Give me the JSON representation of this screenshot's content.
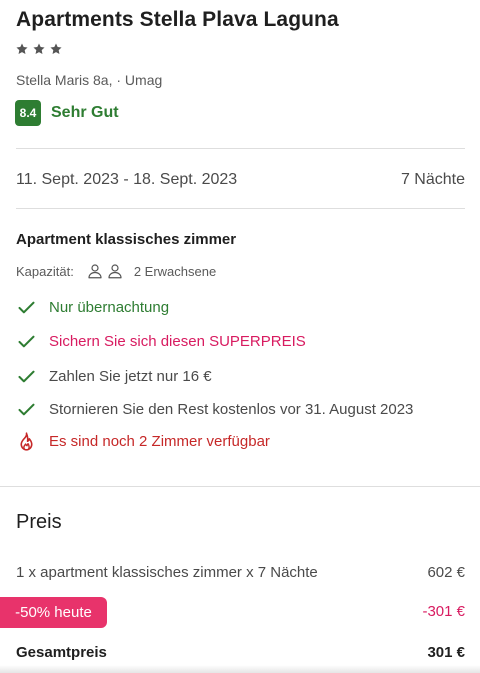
{
  "hotel": {
    "name": "Apartments Stella Plava Laguna",
    "star_count": 3,
    "address": "Stella Maris 8a, · Umag",
    "rating_score": "8.4",
    "rating_label": "Sehr Gut"
  },
  "stay": {
    "dates": "11. Sept. 2023 - 18. Sept. 2023",
    "nights": "7 Nächte"
  },
  "room": {
    "name": "Apartment klassisches zimmer",
    "capacity_label": "Kapazität:",
    "capacity_value": "2 Erwachsene",
    "features": [
      {
        "icon": "check-icon",
        "text": "Nur übernachtung"
      },
      {
        "icon": "check-icon",
        "text": "Sichern Sie sich diesen SUPERPREIS"
      },
      {
        "icon": "check-icon",
        "text": "Zahlen Sie jetzt nur 16 €"
      },
      {
        "icon": "check-icon",
        "text": "Stornieren Sie den Rest kostenlos vor 31. August 2023"
      },
      {
        "icon": "flame-icon",
        "text": "Es sind noch 2 Zimmer verfügbar"
      }
    ]
  },
  "price": {
    "heading": "Preis",
    "line_description": "1 x apartment klassisches zimmer x 7 Nächte",
    "line_amount": "602 €",
    "discount_badge": "-50% heute",
    "discount_amount": "-301 €",
    "total_label": "Gesamtpreis",
    "total_amount": "301 €"
  },
  "colors": {
    "rating_green": "#2e7d32",
    "promo_pink": "#d81b60",
    "badge_pink": "#e8336b",
    "alert_red": "#c62828"
  }
}
